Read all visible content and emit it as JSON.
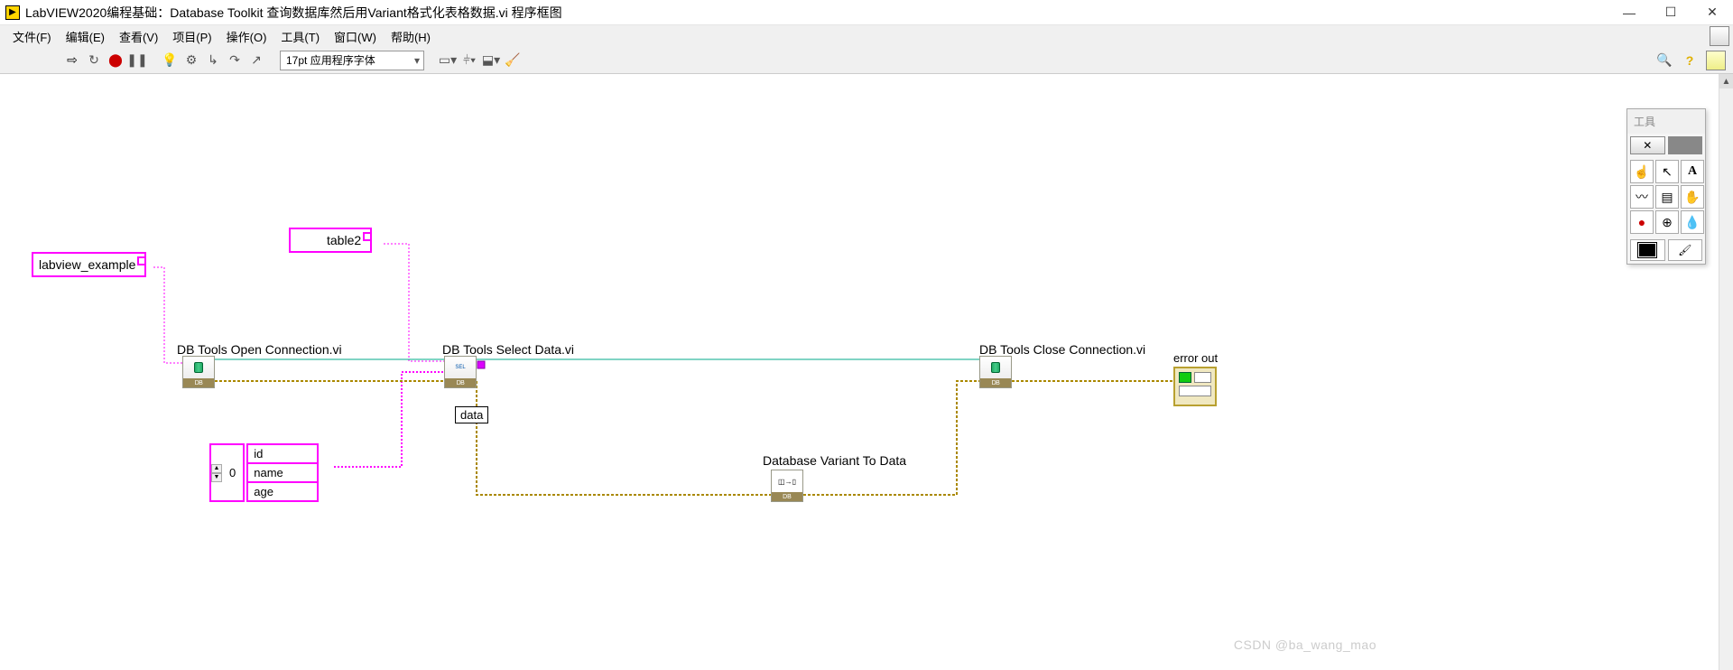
{
  "window": {
    "title": "LabVIEW2020编程基础：Database Toolkit 查询数据库然后用Variant格式化表格数据.vi 程序框图"
  },
  "menus": [
    "文件(F)",
    "编辑(E)",
    "查看(V)",
    "项目(P)",
    "操作(O)",
    "工具(T)",
    "窗口(W)",
    "帮助(H)"
  ],
  "toolbar": {
    "font": "17pt 应用程序字体"
  },
  "tools_palette": {
    "title": "工具"
  },
  "diagram": {
    "const_dsn": "labview_example",
    "const_table": "table2",
    "node_open": "DB Tools Open Connection.vi",
    "node_select": "DB Tools Select Data.vi",
    "node_close": "DB Tools Close Connection.vi",
    "node_variant": "Database Variant To Data",
    "tunnel_data": "data",
    "array_index": "0",
    "columns": [
      "id",
      "name",
      "age"
    ],
    "error_out": "error out",
    "db_tag": "DB"
  },
  "watermark": "CSDN @ba_wang_mao"
}
